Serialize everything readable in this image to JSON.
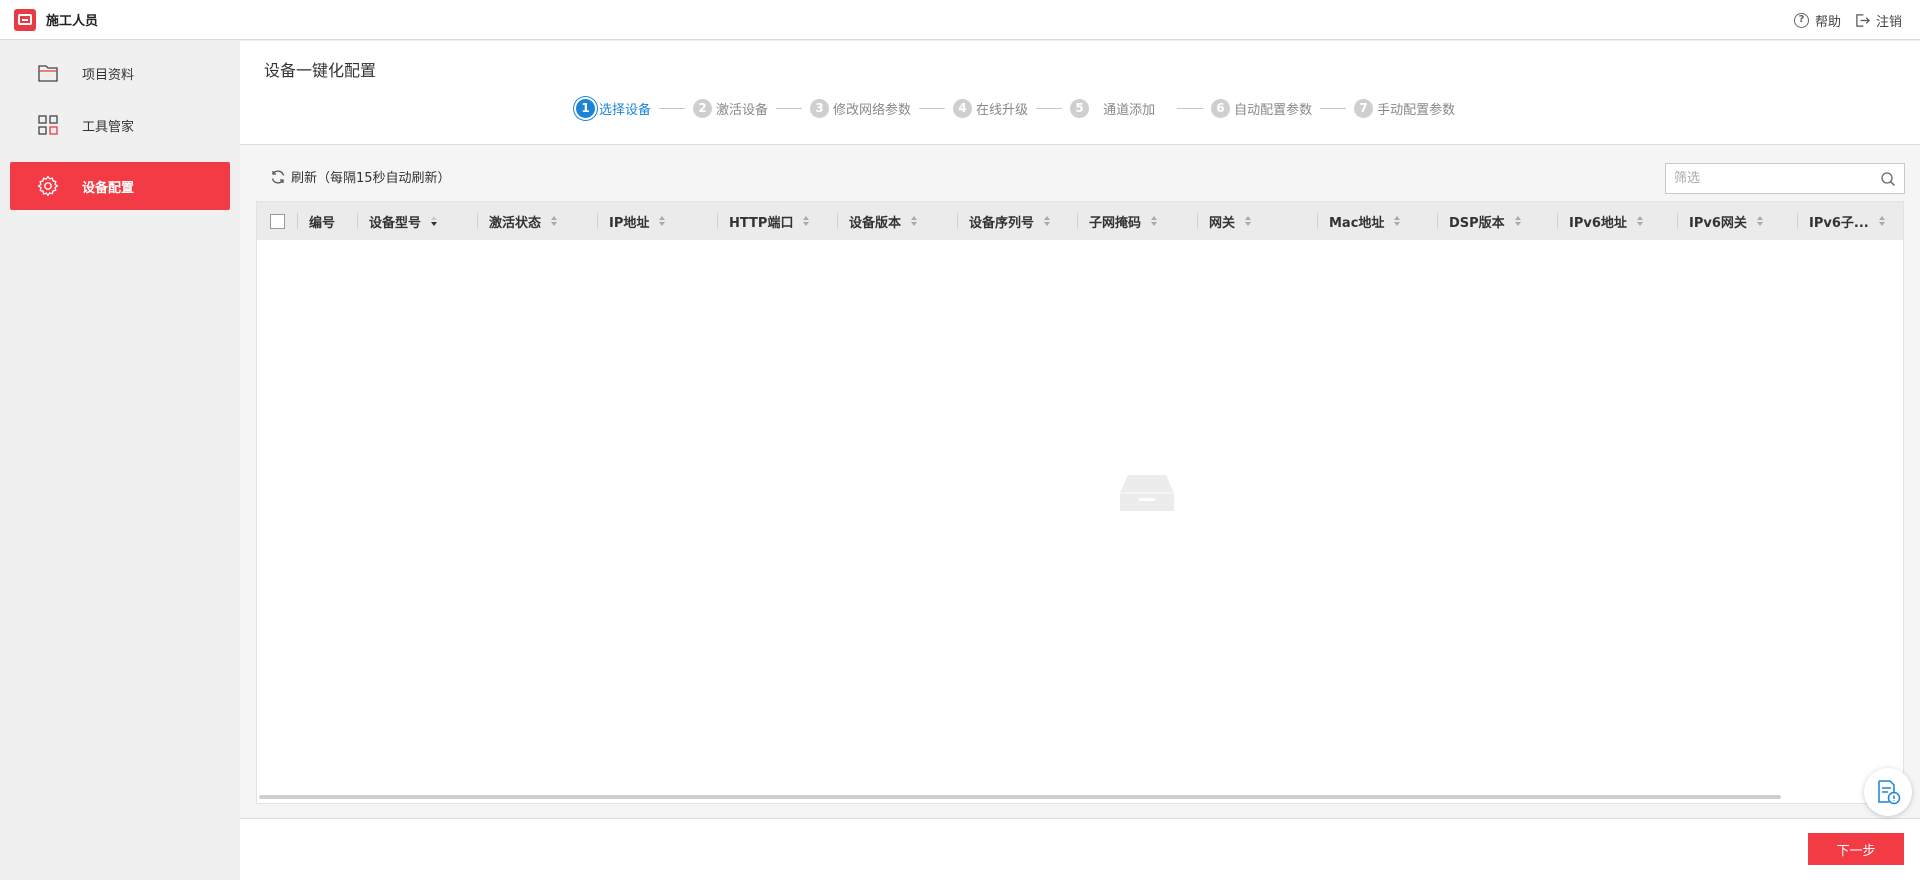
{
  "app": {
    "title": "施工人员"
  },
  "topbar": {
    "help_label": "帮助",
    "logout_label": "注销"
  },
  "sidebar": {
    "items": [
      {
        "label": "项目资料",
        "icon": "folder-icon",
        "active": false
      },
      {
        "label": "工具管家",
        "icon": "grid-icon",
        "active": false
      },
      {
        "label": "设备配置",
        "icon": "gear-icon",
        "active": true
      }
    ]
  },
  "page": {
    "title": "设备一键化配置"
  },
  "steps": [
    {
      "num": "1",
      "label": "选择设备",
      "current": true
    },
    {
      "num": "2",
      "label": "激活设备",
      "current": false
    },
    {
      "num": "3",
      "label": "修改网络参数",
      "current": false
    },
    {
      "num": "4",
      "label": "在线升级",
      "current": false
    },
    {
      "num": "5",
      "label": "通道添加",
      "current": false
    },
    {
      "num": "6",
      "label": "自动配置参数",
      "current": false
    },
    {
      "num": "7",
      "label": "手动配置参数",
      "current": false
    }
  ],
  "toolbar": {
    "refresh_label": "刷新（每隔15秒自动刷新）",
    "filter_placeholder": "筛选"
  },
  "table": {
    "columns": [
      "编号",
      "设备型号",
      "激活状态",
      "IP地址",
      "HTTP端口",
      "设备版本",
      "设备序列号",
      "子网掩码",
      "网关",
      "Mac地址",
      "DSP版本",
      "IPv6地址",
      "IPv6网关",
      "IPv6子..."
    ],
    "sorted_column": "设备型号",
    "sort_direction": "descending",
    "rows": []
  },
  "footer": {
    "next_label": "下一步"
  },
  "colors": {
    "accent": "#f23b45",
    "step_active": "#1c84d6"
  }
}
